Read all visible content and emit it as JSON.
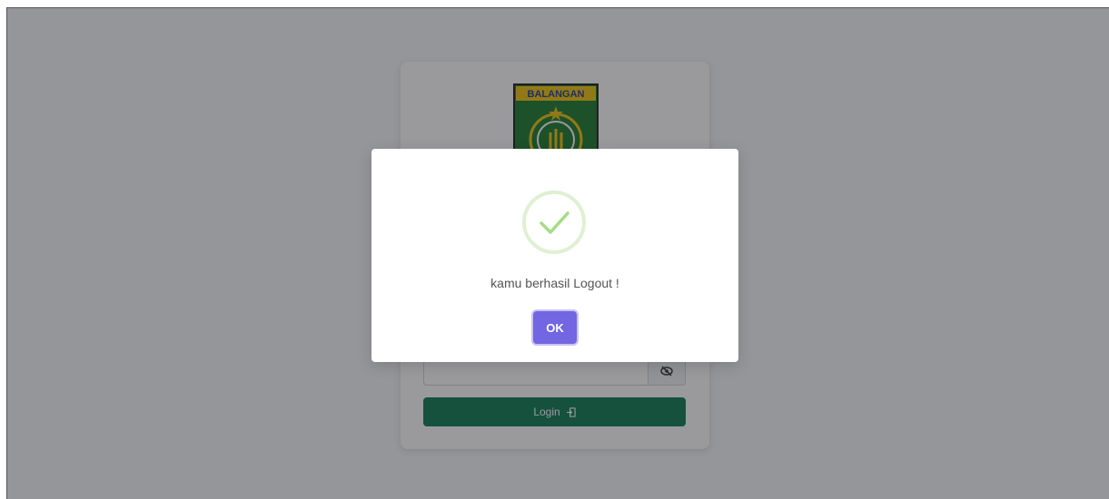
{
  "login": {
    "logo_text": "BALANGAN",
    "button_label": "Login"
  },
  "alert": {
    "message": "kamu berhasil Logout !",
    "ok_label": "OK"
  }
}
